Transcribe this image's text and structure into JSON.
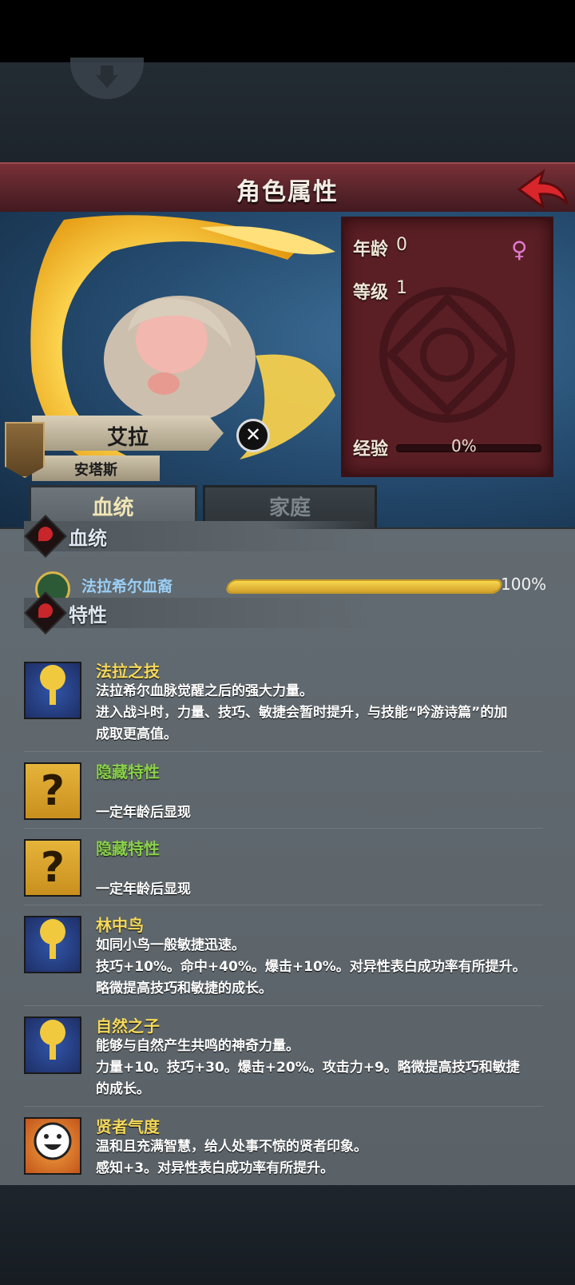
{
  "header": {
    "title": "角色属性"
  },
  "info": {
    "age_label": "年龄",
    "age_value": "0",
    "level_label": "等级",
    "level_value": "1",
    "exp_label": "经验",
    "exp_value": "0%",
    "exp_progress": 0
  },
  "character": {
    "name": "艾拉",
    "surname": "安塔斯"
  },
  "tabs": [
    {
      "label": "血统"
    },
    {
      "label": "家庭"
    }
  ],
  "lineage_section": {
    "title": "血统",
    "entry": {
      "name": "法拉希尔血裔",
      "percent": "100%",
      "progress": 1.0
    }
  },
  "traits_section": {
    "title": "特性"
  },
  "traits": [
    {
      "name": "法拉之技",
      "icon": "tree-icon",
      "color": "gold",
      "lines": [
        "法拉希尔血脉觉醒之后的强大力量。",
        "进入战斗时，力量、技巧、敏捷会暂时提升，与技能“吟游诗篇”的加",
        "成取更高值。"
      ]
    },
    {
      "name": "隐藏特性",
      "icon": "question-icon",
      "color": "green",
      "lines": [
        "一定年龄后显现"
      ]
    },
    {
      "name": "隐藏特性",
      "icon": "question-icon",
      "color": "green",
      "lines": [
        "一定年龄后显现"
      ]
    },
    {
      "name": "林中鸟",
      "icon": "tree-icon",
      "color": "gold",
      "lines": [
        "如同小鸟一般敏捷迅速。",
        "技巧+10%。命中+40%。爆击+10%。对异性表白成功率有所提升。",
        "略微提高技巧和敏捷的成长。"
      ]
    },
    {
      "name": "自然之子",
      "icon": "tree-icon",
      "color": "gold",
      "lines": [
        "能够与自然产生共鸣的神奇力量。",
        "力量+10。技巧+30。爆击+20%。攻击力+9。略微提高技巧和敏捷",
        "的成长。"
      ]
    },
    {
      "name": "贤者气度",
      "icon": "smiley-icon",
      "color": "gold",
      "lines": [
        "温和且充满智慧，给人处事不惊的贤者印象。",
        "感知+3。对异性表白成功率有所提升。"
      ]
    }
  ]
}
